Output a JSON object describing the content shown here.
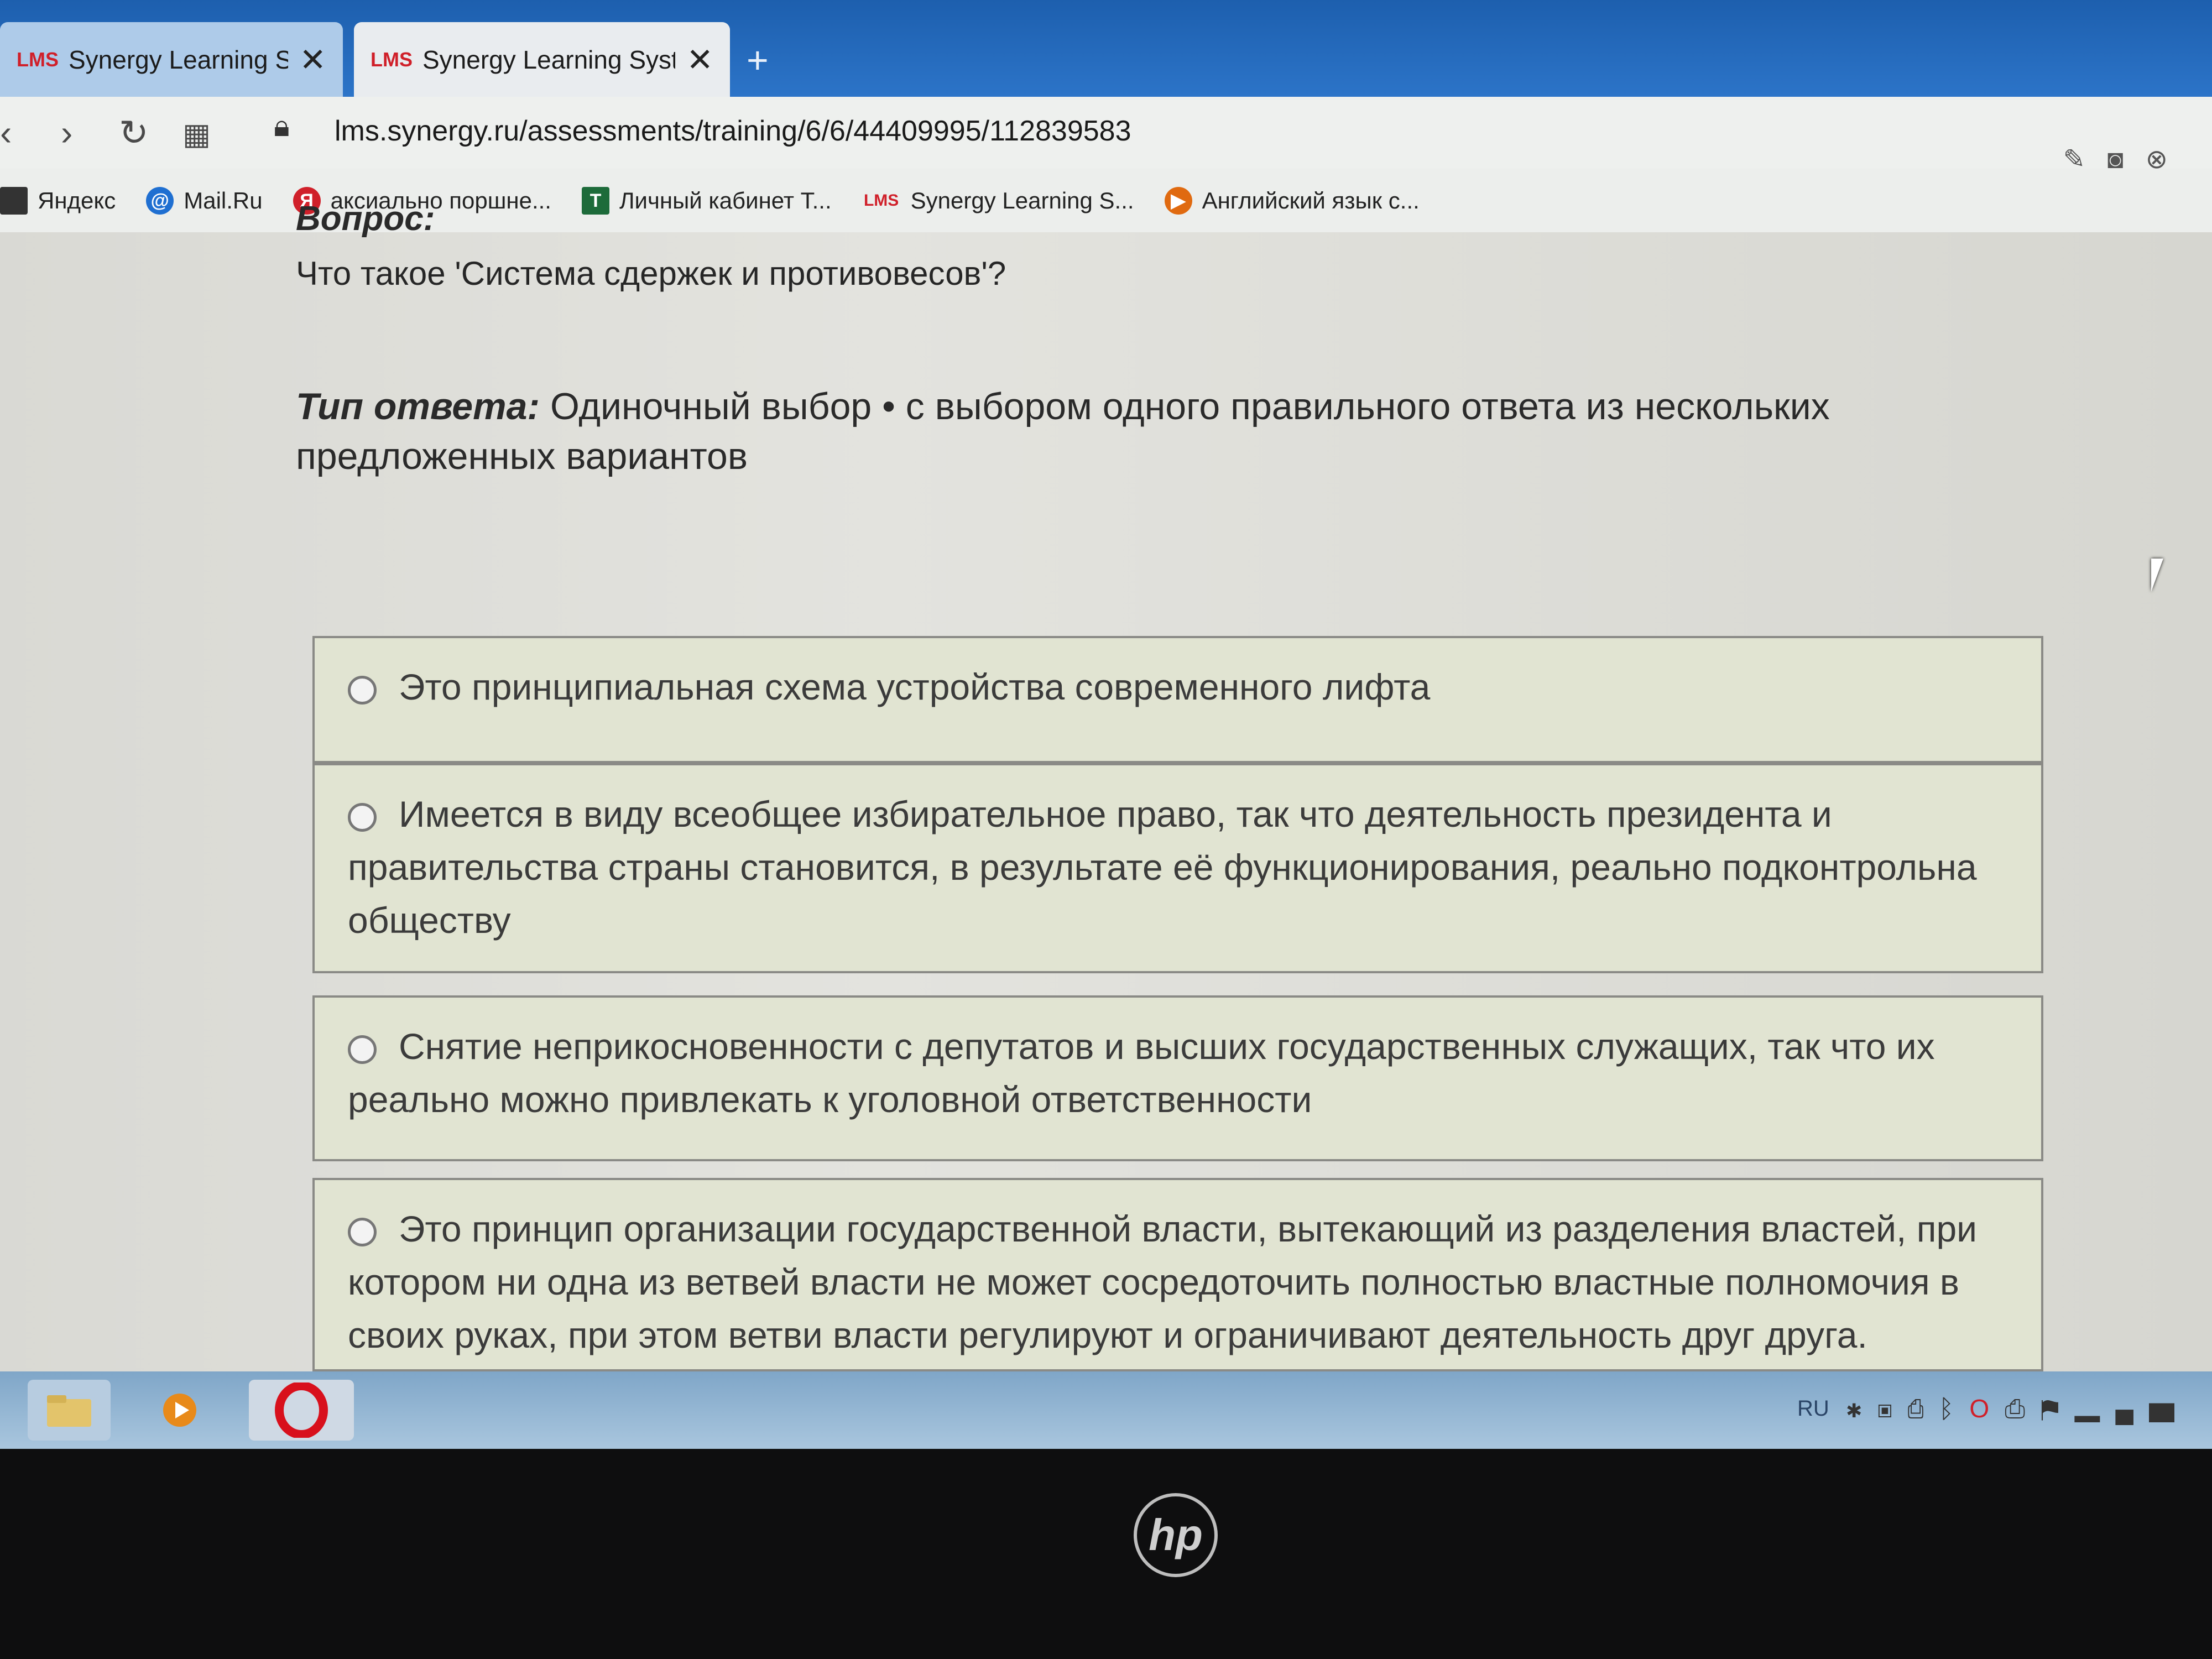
{
  "browser": {
    "tabs": [
      {
        "logo": "LMS",
        "label": "Synergy Learning System",
        "close": "✕"
      },
      {
        "logo": "LMS",
        "label": "Synergy Learning System",
        "close": "✕"
      }
    ],
    "new_tab": "+",
    "url": "lms.synergy.ru/assessments/training/6/6/44409995/112839583",
    "nav_icons": [
      "back-icon",
      "forward-icon",
      "reload-icon",
      "grid-icon",
      "lock-icon"
    ],
    "bookmarks": [
      {
        "label": "Яндекс",
        "icon": "page-icon",
        "color": "#333333"
      },
      {
        "label": "Mail.Ru",
        "icon": "mail-icon",
        "color": "#1f6fd1"
      },
      {
        "label": "аксиально поршне...",
        "icon": "yandex-icon",
        "color": "#d0202a"
      },
      {
        "label": "Личный кабинет Т...",
        "icon": "t-icon",
        "color": "#1d6b3a"
      },
      {
        "label": "Synergy Learning S...",
        "icon": "lms-icon",
        "color": "#d0202a"
      },
      {
        "label": "Английский язык с...",
        "icon": "play-icon",
        "color": "#e06a10"
      }
    ],
    "right_tools": [
      "edit-icon",
      "camera-icon",
      "settings-icon"
    ]
  },
  "page": {
    "question_label": "Вопрос:",
    "question_text": "Что такое 'Система сдержек и противовесов'?",
    "answer_type_label": "Тип ответа:",
    "answer_type_text": "Одиночный выбор • с выбором одного правильного ответа из нескольких предложенных вариантов",
    "options": [
      "Это принципиальная схема устройства современного лифта",
      "Имеется в виду всеобщее избирательное право, так что деятельность президента и правительства страны становится, в результате её функционирования, реально подконтрольна обществу",
      "Снятие неприкосновенности с депутатов и высших государственных служащих, так что их реально можно привлекать к уголовной ответственности",
      "Это принцип организации государственной власти, вытекающий из разделения властей, при котором ни одна из ветвей власти не может сосредоточить полностью властные полномочия в своих руках, при этом ветви власти регулируют и ограничивают деятельность друг друга."
    ]
  },
  "taskbar": {
    "apps": [
      "file-explorer-icon",
      "media-player-icon",
      "opera-icon"
    ],
    "language": "RU",
    "tray_icons": [
      "network-icon",
      "window-icon",
      "device-icon",
      "bluetooth-icon",
      "opera-tray-icon",
      "printer-icon",
      "flag-icon",
      "signal-icon"
    ]
  },
  "bezel": {
    "logo": "hp"
  },
  "colors": {
    "tab_strip": "#2c74c8",
    "lms_red": "#d0202a",
    "option_bg": "#e1e4d2"
  }
}
